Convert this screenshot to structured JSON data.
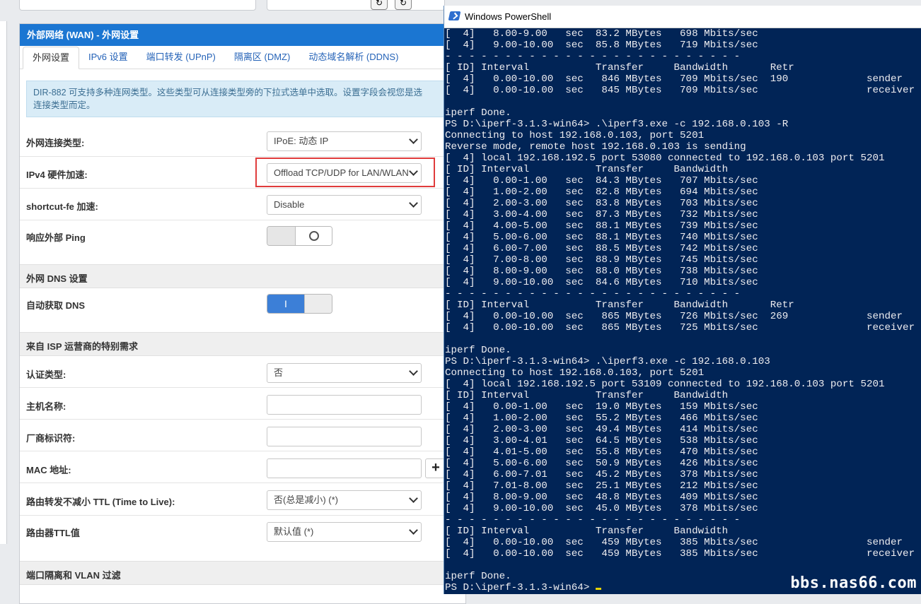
{
  "router": {
    "header_title": "外部网络 (WAN) - 外网设置",
    "tabs": [
      "外网设置",
      "IPv6 设置",
      "端口转发 (UPnP)",
      "隔离区 (DMZ)",
      "动态域名解析 (DDNS)"
    ],
    "info_line1": "DIR-882 可支持多种连网类型。这些类型可从连接类型旁的下拉式选单中选取。设置字段会视您是选",
    "info_line2": "连接类型而定。",
    "fields": {
      "wan_type_label": "外网连接类型:",
      "wan_type_value": "IPoE: 动态 IP",
      "hw_accel_label": "IPv4 硬件加速:",
      "hw_accel_value": "Offload TCP/UDP for LAN/WLAN",
      "shortcut_label": "shortcut-fe 加速:",
      "shortcut_value": "Disable",
      "ping_label": "响应外部 Ping",
      "dns_section": "外网 DNS 设置",
      "auto_dns_label": "自动获取 DNS",
      "auto_dns_on_glyph": "I",
      "isp_section": "来自 ISP 运营商的特别需求",
      "auth_label": "认证类型:",
      "auth_value": "否",
      "hostname_label": "主机名称:",
      "vendor_label": "厂商标识符:",
      "mac_label": "MAC 地址:",
      "mac_plus": "+",
      "ttl_keep_label": "路由转发不减小 TTL (Time to Live):",
      "ttl_keep_value": "否(总是减小) (*)",
      "ttl_value_label": "路由器TTL值",
      "ttl_value_value": "默认值 (*)",
      "vlan_section": "端口隔离和 VLAN 过滤"
    }
  },
  "powershell": {
    "title": "Windows PowerShell",
    "lines": [
      "[  4]   8.00-9.00   sec  83.2 MBytes   698 Mbits/sec",
      "[  4]   9.00-10.00  sec  85.8 MBytes   719 Mbits/sec",
      "- - - - - - - - - - - - - - - - - - - - - - - - -",
      "[ ID] Interval           Transfer     Bandwidth       Retr",
      "[  4]   0.00-10.00  sec   846 MBytes   709 Mbits/sec  190             sender",
      "[  4]   0.00-10.00  sec   845 MBytes   709 Mbits/sec                  receiver",
      "",
      "iperf Done.",
      "PS D:\\iperf-3.1.3-win64> .\\iperf3.exe -c 192.168.0.103 -R",
      "Connecting to host 192.168.0.103, port 5201",
      "Reverse mode, remote host 192.168.0.103 is sending",
      "[  4] local 192.168.192.5 port 53080 connected to 192.168.0.103 port 5201",
      "[ ID] Interval           Transfer     Bandwidth",
      "[  4]   0.00-1.00   sec  84.3 MBytes   707 Mbits/sec",
      "[  4]   1.00-2.00   sec  82.8 MBytes   694 Mbits/sec",
      "[  4]   2.00-3.00   sec  83.8 MBytes   703 Mbits/sec",
      "[  4]   3.00-4.00   sec  87.3 MBytes   732 Mbits/sec",
      "[  4]   4.00-5.00   sec  88.1 MBytes   739 Mbits/sec",
      "[  4]   5.00-6.00   sec  88.1 MBytes   740 Mbits/sec",
      "[  4]   6.00-7.00   sec  88.5 MBytes   742 Mbits/sec",
      "[  4]   7.00-8.00   sec  88.9 MBytes   745 Mbits/sec",
      "[  4]   8.00-9.00   sec  88.0 MBytes   738 Mbits/sec",
      "[  4]   9.00-10.00  sec  84.6 MBytes   710 Mbits/sec",
      "- - - - - - - - - - - - - - - - - - - - - - - - -",
      "[ ID] Interval           Transfer     Bandwidth       Retr",
      "[  4]   0.00-10.00  sec   865 MBytes   726 Mbits/sec  269             sender",
      "[  4]   0.00-10.00  sec   865 MBytes   725 Mbits/sec                  receiver",
      "",
      "iperf Done.",
      "PS D:\\iperf-3.1.3-win64> .\\iperf3.exe -c 192.168.0.103",
      "Connecting to host 192.168.0.103, port 5201",
      "[  4] local 192.168.192.5 port 53109 connected to 192.168.0.103 port 5201",
      "[ ID] Interval           Transfer     Bandwidth",
      "[  4]   0.00-1.00   sec  19.0 MBytes   159 Mbits/sec",
      "[  4]   1.00-2.00   sec  55.2 MBytes   466 Mbits/sec",
      "[  4]   2.00-3.00   sec  49.4 MBytes   414 Mbits/sec",
      "[  4]   3.00-4.01   sec  64.5 MBytes   538 Mbits/sec",
      "[  4]   4.01-5.00   sec  55.8 MBytes   470 Mbits/sec",
      "[  4]   5.00-6.00   sec  50.9 MBytes   426 Mbits/sec",
      "[  4]   6.00-7.01   sec  45.2 MBytes   378 Mbits/sec",
      "[  4]   7.01-8.00   sec  25.1 MBytes   212 Mbits/sec",
      "[  4]   8.00-9.00   sec  48.8 MBytes   409 Mbits/sec",
      "[  4]   9.00-10.00  sec  45.0 MBytes   378 Mbits/sec",
      "- - - - - - - - - - - - - - - - - - - - - - - - -",
      "[ ID] Interval           Transfer     Bandwidth",
      "[  4]   0.00-10.00  sec   459 MBytes   385 Mbits/sec                  sender",
      "[  4]   0.00-10.00  sec   459 MBytes   385 Mbits/sec                  receiver",
      "",
      "iperf Done.",
      "PS D:\\iperf-3.1.3-win64> "
    ],
    "watermark": "bbs.nas66.com"
  },
  "colors": {
    "router_header": "#1b76d2",
    "powershell_bg": "#012456",
    "highlight_box": "#e03c3c",
    "toggle_on": "#3c7fd7"
  }
}
